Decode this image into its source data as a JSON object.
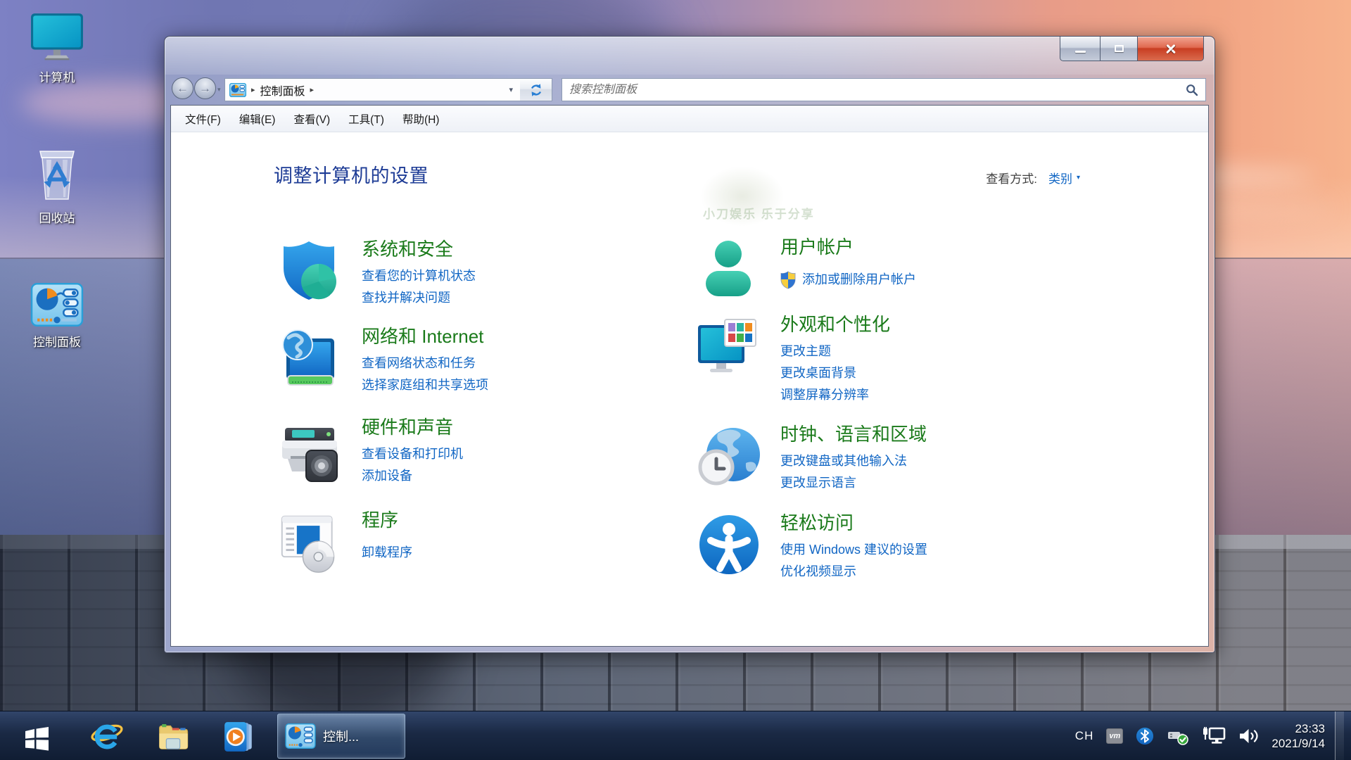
{
  "desktop": {
    "icons": [
      {
        "label": "计算机"
      },
      {
        "label": "回收站"
      },
      {
        "label": "控制面板"
      }
    ]
  },
  "window": {
    "address": {
      "breadcrumb_item": "控制面板",
      "search_placeholder": "搜索控制面板"
    },
    "menu": {
      "items": [
        "文件(F)",
        "编辑(E)",
        "查看(V)",
        "工具(T)",
        "帮助(H)"
      ]
    },
    "page_title": "调整计算机的设置",
    "view_by_label": "查看方式:",
    "view_by_value": "类别",
    "watermark": "小刀娱乐 乐于分享",
    "categories": [
      {
        "title": "系统和安全",
        "links": [
          "查看您的计算机状态",
          "查找并解决问题"
        ]
      },
      {
        "title": "网络和 Internet",
        "links": [
          "查看网络状态和任务",
          "选择家庭组和共享选项"
        ]
      },
      {
        "title": "硬件和声音",
        "links": [
          "查看设备和打印机",
          "添加设备"
        ]
      },
      {
        "title": "程序",
        "links": [
          "卸载程序"
        ]
      },
      {
        "title": "用户帐户",
        "links": [
          "添加或删除用户帐户"
        ]
      },
      {
        "title": "外观和个性化",
        "links": [
          "更改主题",
          "更改桌面背景",
          "调整屏幕分辨率"
        ]
      },
      {
        "title": "时钟、语言和区域",
        "links": [
          "更改键盘或其他输入法",
          "更改显示语言"
        ]
      },
      {
        "title": "轻松访问",
        "links": [
          "使用 Windows 建议的设置",
          "优化视频显示"
        ]
      }
    ]
  },
  "taskbar": {
    "active_task_label": "控制...",
    "tray": {
      "language": "CH",
      "vm_badge": "vm",
      "time": "23:33",
      "date": "2021/9/14"
    }
  },
  "icons": {
    "breadcrumb_arrow": "▸",
    "dropdown_arrow": "▾",
    "back_arrow": "←",
    "forward_arrow": "→"
  },
  "colors": {
    "category_title_green": "#1a7a1a",
    "link_blue": "#1166c4",
    "page_title_blue": "#1e3c96",
    "close_button_red": "#c83e22"
  }
}
